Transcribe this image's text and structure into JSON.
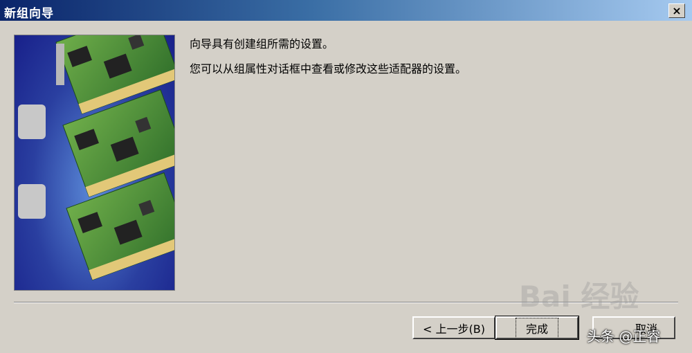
{
  "window": {
    "title": "新组向导",
    "close_label": "×"
  },
  "wizard_image": {
    "description_icon": "network-adapter-cards-illustration"
  },
  "content": {
    "line1": "向导具有创建组所需的设置。",
    "line2": "您可以从组属性对话框中查看或修改这些适配器的设置。"
  },
  "buttons": {
    "back": "< 上一步(B)",
    "finish": "完成",
    "cancel": "取消"
  },
  "watermarks": {
    "baidu": "Bai 经验",
    "toutiao": "头条 @正睿"
  },
  "colors": {
    "titlebar_start": "#0a246a",
    "titlebar_end": "#a6caf0",
    "dialog_bg": "#d4d0c8"
  }
}
